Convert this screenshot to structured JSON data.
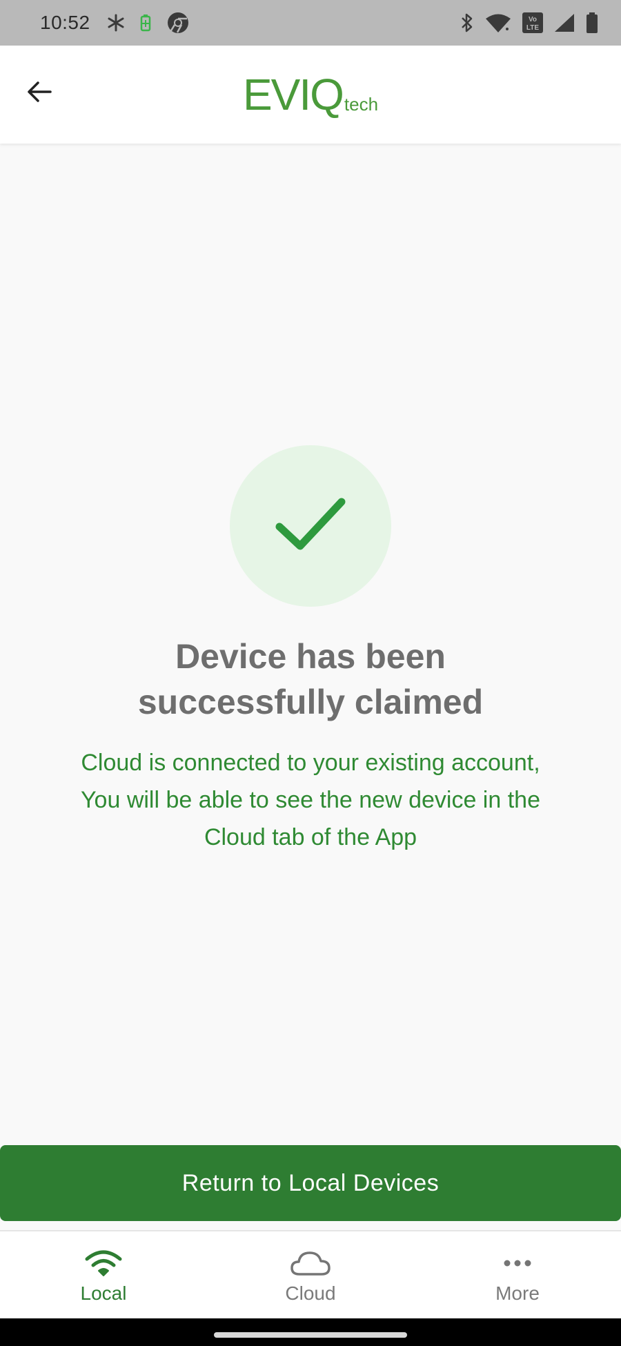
{
  "status_bar": {
    "time": "10:52",
    "icons_left": [
      "pinwheel-icon",
      "battery-saver-icon",
      "chrome-icon"
    ],
    "icons_right": [
      "bluetooth-icon",
      "wifi-icon",
      "volte-icon",
      "signal-icon",
      "battery-icon"
    ],
    "volte_text": "Vo LTE"
  },
  "app_bar": {
    "back_icon": "arrow-left-icon",
    "logo_main": "EVIQ",
    "logo_sub": "tech",
    "logo_color": "#4a9a3a"
  },
  "main": {
    "success_icon": "checkmark-icon",
    "heading_line1": "Device has been",
    "heading_line2": "successfully claimed",
    "message_line1": "Cloud is connected to your existing account,",
    "message_line2": "You will be able to see the new device in the",
    "message_line3": "Cloud tab of the App"
  },
  "primary_button": {
    "label": "Return to Local Devices",
    "color": "#2e7d32"
  },
  "bottom_nav": {
    "items": [
      {
        "label": "Local",
        "icon": "wifi-icon",
        "active": true
      },
      {
        "label": "Cloud",
        "icon": "cloud-icon",
        "active": false
      },
      {
        "label": "More",
        "icon": "more-horizontal-icon",
        "active": false
      }
    ]
  },
  "colors": {
    "accent": "#2e7d32",
    "text_green": "#2f8a33",
    "success_bg": "#e6f5e6",
    "heading_gray": "#6e6e6e"
  }
}
